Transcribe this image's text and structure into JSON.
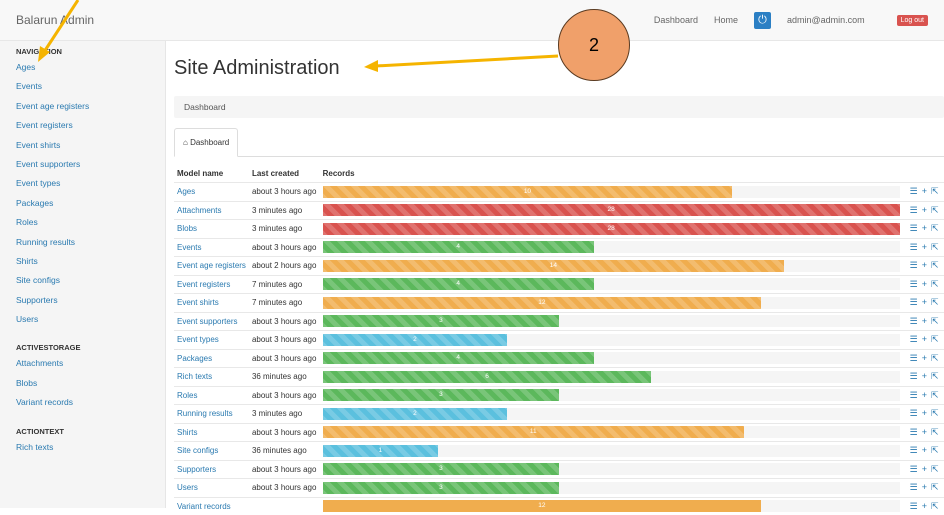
{
  "brand": "Balarun Admin",
  "topnav": {
    "dashboard": "Dashboard",
    "home": "Home",
    "user": "admin@admin.com",
    "logout": "Log out"
  },
  "sidebar": {
    "sections": [
      {
        "title": "NAVIGATION",
        "items": [
          "Ages",
          "Events",
          "Event age registers",
          "Event registers",
          "Event shirts",
          "Event supporters",
          "Event types",
          "Packages",
          "Roles",
          "Running results",
          "Shirts",
          "Site configs",
          "Supporters",
          "Users"
        ]
      },
      {
        "title": "ACTIVESTORAGE",
        "items": [
          "Attachments",
          "Blobs",
          "Variant records"
        ]
      },
      {
        "title": "ACTIONTEXT",
        "items": [
          "Rich texts"
        ]
      }
    ]
  },
  "main": {
    "title": "Site Administration",
    "breadcrumb": "Dashboard",
    "tab": "Dashboard",
    "columns": [
      "Model name",
      "Last created",
      "Records"
    ],
    "rows": [
      {
        "name": "Ages",
        "created": "about 3 hours ago",
        "count": "10",
        "fraction": 0.71,
        "color": "#f0ad4e"
      },
      {
        "name": "Attachments",
        "created": "3 minutes ago",
        "count": "28",
        "fraction": 1.0,
        "color": "#d9534f"
      },
      {
        "name": "Blobs",
        "created": "3 minutes ago",
        "count": "28",
        "fraction": 1.0,
        "color": "#d9534f"
      },
      {
        "name": "Events",
        "created": "about 3 hours ago",
        "count": "4",
        "fraction": 0.47,
        "color": "#5cb85c"
      },
      {
        "name": "Event age registers",
        "created": "about 2 hours ago",
        "count": "14",
        "fraction": 0.8,
        "color": "#f0ad4e"
      },
      {
        "name": "Event registers",
        "created": "7 minutes ago",
        "count": "4",
        "fraction": 0.47,
        "color": "#5cb85c"
      },
      {
        "name": "Event shirts",
        "created": "7 minutes ago",
        "count": "12",
        "fraction": 0.76,
        "color": "#f0ad4e"
      },
      {
        "name": "Event supporters",
        "created": "about 3 hours ago",
        "count": "3",
        "fraction": 0.41,
        "color": "#5cb85c"
      },
      {
        "name": "Event types",
        "created": "about 3 hours ago",
        "count": "2",
        "fraction": 0.32,
        "color": "#5bc0de"
      },
      {
        "name": "Packages",
        "created": "about 3 hours ago",
        "count": "4",
        "fraction": 0.47,
        "color": "#5cb85c"
      },
      {
        "name": "Rich texts",
        "created": "36 minutes ago",
        "count": "6",
        "fraction": 0.57,
        "color": "#5cb85c"
      },
      {
        "name": "Roles",
        "created": "about 3 hours ago",
        "count": "3",
        "fraction": 0.41,
        "color": "#5cb85c"
      },
      {
        "name": "Running results",
        "created": "3 minutes ago",
        "count": "2",
        "fraction": 0.32,
        "color": "#5bc0de"
      },
      {
        "name": "Shirts",
        "created": "about 3 hours ago",
        "count": "11",
        "fraction": 0.73,
        "color": "#f0ad4e"
      },
      {
        "name": "Site configs",
        "created": "36 minutes ago",
        "count": "1",
        "fraction": 0.2,
        "color": "#5bc0de"
      },
      {
        "name": "Supporters",
        "created": "about 3 hours ago",
        "count": "3",
        "fraction": 0.41,
        "color": "#5cb85c"
      },
      {
        "name": "Users",
        "created": "about 3 hours ago",
        "count": "3",
        "fraction": 0.41,
        "color": "#5cb85c"
      },
      {
        "name": "Variant records",
        "created": "",
        "count": "12",
        "fraction": 0.76,
        "color": "#f0ad4e",
        "plain": true
      }
    ]
  },
  "annotation": {
    "label": "2",
    "color": "#f5b400"
  }
}
